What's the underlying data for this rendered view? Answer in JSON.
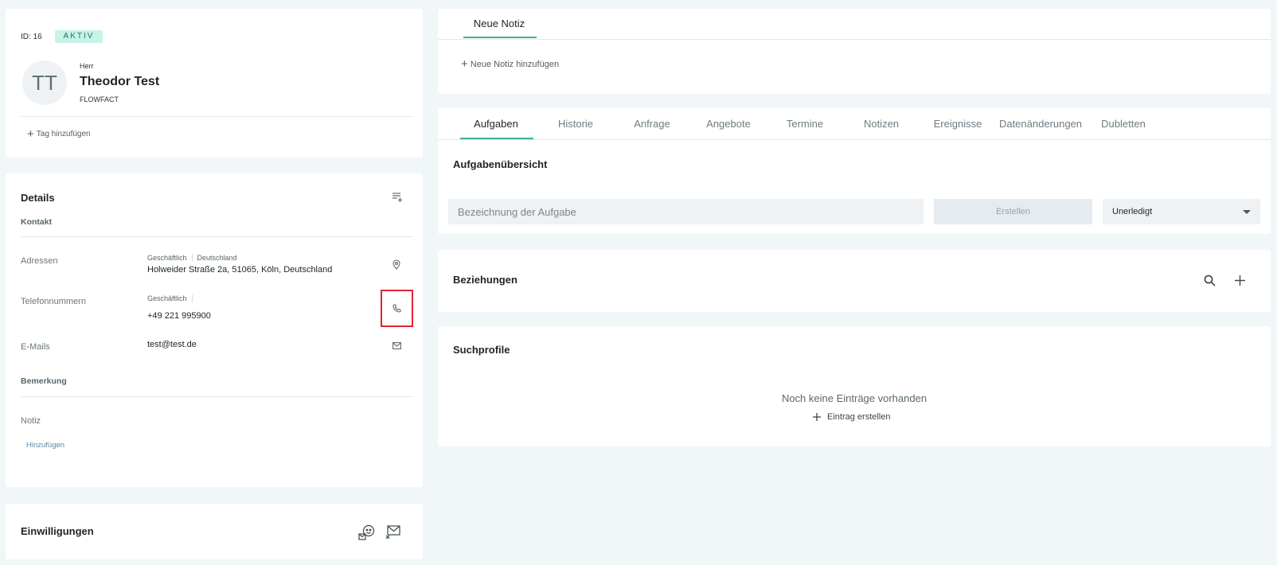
{
  "profile": {
    "id_text": "ID: 16",
    "status": "AKTIV",
    "initials": "TT",
    "salutation": "Herr",
    "name": "Theodor Test",
    "company": "FLOWFACT",
    "add_tag": "Tag hinzufügen"
  },
  "details": {
    "title": "Details",
    "contact_section": "Kontakt",
    "addresses_label": "Adressen",
    "address_type": "Geschäftlich",
    "address_country": "Deutschland",
    "address_value": "Holweider Straße 2a, 51065, Köln, Deutschland",
    "phones_label": "Telefonnummern",
    "phone_type": "Geschäftlich",
    "phone_value": "+49 221 995900",
    "emails_label": "E-Mails",
    "email_value": "test@test.de",
    "remark_section": "Bemerkung",
    "note_label": "Notiz",
    "note_add": "Hinzufügen"
  },
  "consent": {
    "title": "Einwilligungen"
  },
  "note_panel": {
    "tab": "Neue Notiz",
    "add_note": "Neue Notiz hinzufügen"
  },
  "tabs": [
    "Aufgaben",
    "Historie",
    "Anfrage",
    "Angebote",
    "Termine",
    "Notizen",
    "Ereignisse",
    "Datenänderungen",
    "Dubletten"
  ],
  "tasks": {
    "title": "Aufgabenübersicht",
    "input_placeholder": "Bezeichnung der Aufgabe",
    "create_button": "Erstellen",
    "filter_value": "Unerledigt"
  },
  "relations": {
    "title": "Beziehungen"
  },
  "search_profiles": {
    "title": "Suchprofile",
    "empty_text": "Noch keine Einträge vorhanden",
    "create_entry": "Eintrag erstellen"
  },
  "colors": {
    "accent": "#3bb09b",
    "badge_bg": "#c6f3e6",
    "highlight": "#e0242f",
    "background": "#f1f6f8"
  }
}
